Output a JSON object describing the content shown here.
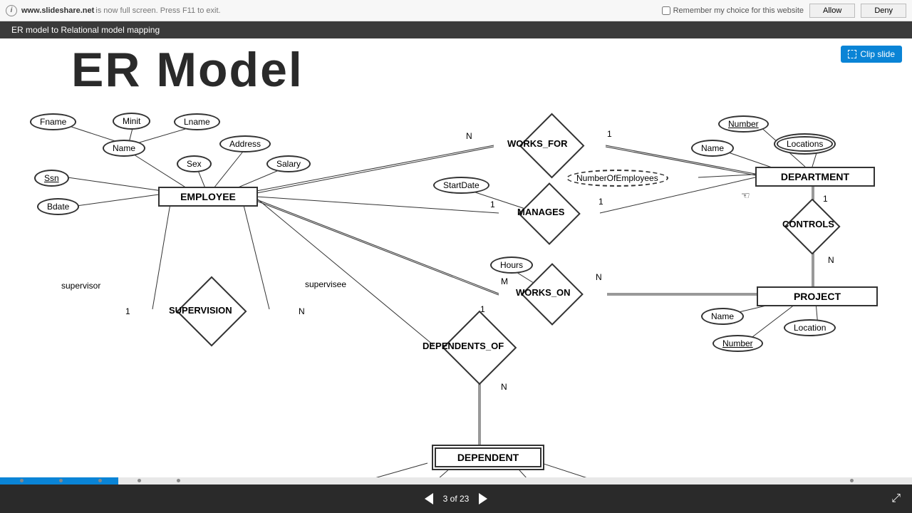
{
  "notification": {
    "url": "www.slideshare.net",
    "message": " is now full screen. Press F11 to exit.",
    "remember": "Remember my choice for this website",
    "allow": "Allow",
    "deny": "Deny"
  },
  "title_bar": "ER model to Relational model mapping",
  "clip_button": "Clip slide",
  "slide": {
    "title": "ER Model",
    "entities": {
      "employee": "EMPLOYEE",
      "department": "DEPARTMENT",
      "project": "PROJECT",
      "dependent": "DEPENDENT"
    },
    "relationships": {
      "works_for": "WORKS_FOR",
      "manages": "MANAGES",
      "controls": "CONTROLS",
      "works_on": "WORKS_ON",
      "supervision": "SUPERVISION",
      "dependents_of": "DEPENDENTS_OF"
    },
    "attributes": {
      "fname": "Fname",
      "minit": "Minit",
      "lname": "Lname",
      "name": "Name",
      "address": "Address",
      "sex": "Sex",
      "salary": "Salary",
      "ssn": "Ssn",
      "bdate": "Bdate",
      "startdate": "StartDate",
      "numemployees": "NumberOfEmployees",
      "dept_name": "Name",
      "dept_number": "Number",
      "locations": "Locations",
      "hours": "Hours",
      "proj_name": "Name",
      "proj_location": "Location",
      "proj_number": "Number"
    },
    "roles": {
      "supervisor": "supervisor",
      "supervisee": "supervisee"
    },
    "cardinalities": {
      "one": "1",
      "n": "N",
      "m": "M"
    }
  },
  "nav": {
    "page_indicator": "3 of 23"
  }
}
